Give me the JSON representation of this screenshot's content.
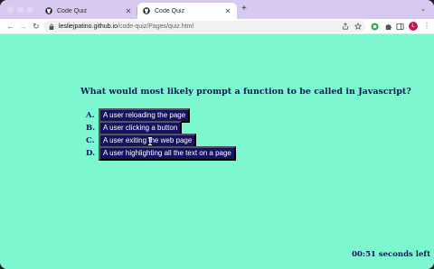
{
  "browser": {
    "tabs": [
      {
        "title": "Code Quiz",
        "active": false
      },
      {
        "title": "Code Quiz",
        "active": true
      }
    ],
    "new_tab_label": "+",
    "url_host": "lesliejpatino.github.io",
    "url_path": "/code-quiz/Pages/quiz.html",
    "profile_initial": "L",
    "colors": {
      "chrome": "#d7c9f0",
      "profile": "#c2185b"
    }
  },
  "quiz": {
    "question": "What would most likely prompt a function to be called in Javascript?",
    "answers": [
      {
        "letter": "A.",
        "text": "A user reloading the page"
      },
      {
        "letter": "B.",
        "text": "A user clicking a button"
      },
      {
        "letter": "C.",
        "text": "A user exiting the web page"
      },
      {
        "letter": "D.",
        "text": "A user highlighting all the text on a page"
      }
    ],
    "timer": "00:51 seconds left",
    "colors": {
      "background": "#7cf7cf",
      "text": "#15135f",
      "button": "#15135f",
      "button_text": "#ffffff"
    }
  }
}
